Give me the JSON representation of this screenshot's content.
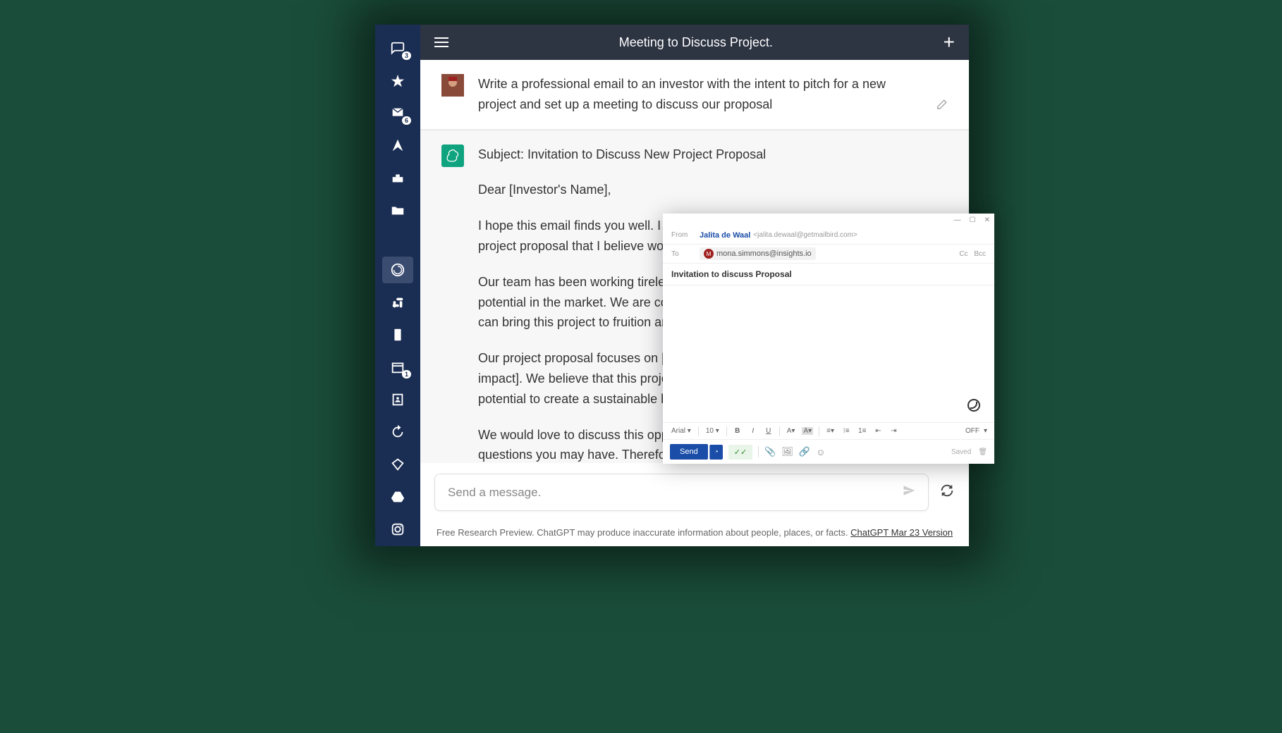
{
  "topbar": {
    "title": "Meeting to Discuss Project."
  },
  "sidebar": {
    "inbox_badge": "3",
    "mail_badge": "6",
    "calendar_badge": "1"
  },
  "messages": {
    "user_prompt": "Write a professional email to an investor with the intent to pitch for a new project and set up a meeting to discuss our proposal",
    "ai": {
      "subject": "Subject: Invitation to Discuss New Project Proposal",
      "greeting": "Dear [Investor's Name],",
      "p1": "I hope this email finds you well. I am reaching out to you today to discuss a new project proposal that I believe would be of great interest to you.",
      "p2": "Our team has been working tirelessly on a project that we feel has tremendous potential in the market. We are confident that with your support and backing, we can bring this project to fruition and make a significant impact in the industry.",
      "p3": "Our project proposal focuses on [briefly describe the project and its potential impact]. We believe that this project has a strong value proposition and has the potential to create a sustainable business model.",
      "p4": "We would love to discuss this opportunity with you in more detail and answer any questions you may have. Therefore, we would like to invite you to a meeting to discuss our project in detail."
    }
  },
  "input": {
    "placeholder": "Send a message."
  },
  "footer": {
    "text": "Free Research Preview. ChatGPT may produce inaccurate information about people, places, or facts. ",
    "link": "ChatGPT Mar 23 Version"
  },
  "compose": {
    "from_label": "From",
    "from_name": "Jalita de Waal",
    "from_email": "<jalita.dewaal@getmailbird.com>",
    "to_label": "To",
    "to_initial": "M",
    "to_email": "mona.simmons@insights.io",
    "cc": "Cc",
    "bcc": "Bcc",
    "subject": "Invitation to discuss Proposal",
    "font": "Arial",
    "fontsize": "10",
    "off": "OFF",
    "send": "Send",
    "saved": "Saved"
  }
}
